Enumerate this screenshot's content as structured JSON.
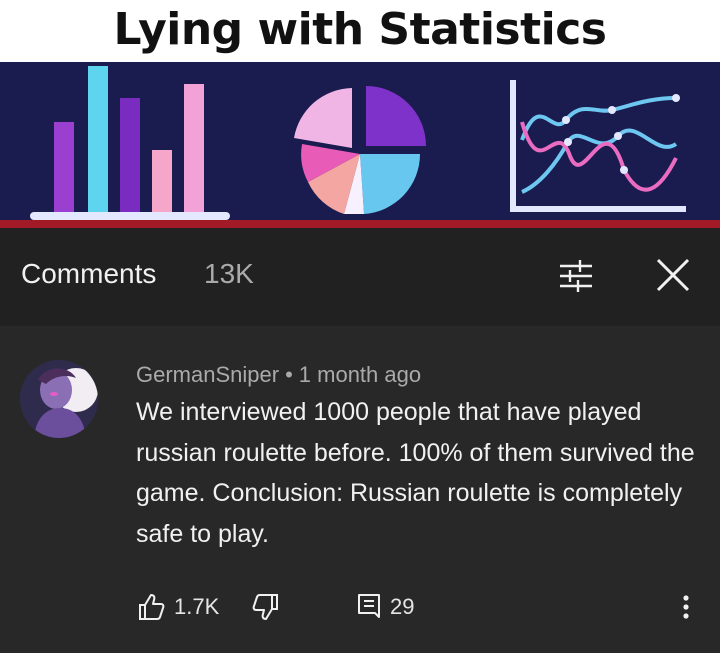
{
  "banner": {
    "title": "Lying with Statistics"
  },
  "header": {
    "title": "Comments",
    "count": "13K"
  },
  "comment": {
    "author": "GermanSniper",
    "separator": "•",
    "time": "1 month ago",
    "text": "We interviewed 1000 people that have played russian roulette before. 100% of them survived the game. Conclusion: Russian roulette is completely safe to play.",
    "likes": "1.7K",
    "replies": "29"
  },
  "icons": {
    "sort": "sort-icon",
    "close": "close-icon",
    "like": "thumbs-up-icon",
    "dislike": "thumbs-down-icon",
    "replies": "reply-icon",
    "more": "more-vertical-icon"
  },
  "colors": {
    "background": "#282828",
    "header_bg": "#212121",
    "banner_bg": "#1a1b4e",
    "banner_redline": "#a11a25",
    "text_primary": "#f1f1f1",
    "text_secondary": "#aaaaaa"
  }
}
